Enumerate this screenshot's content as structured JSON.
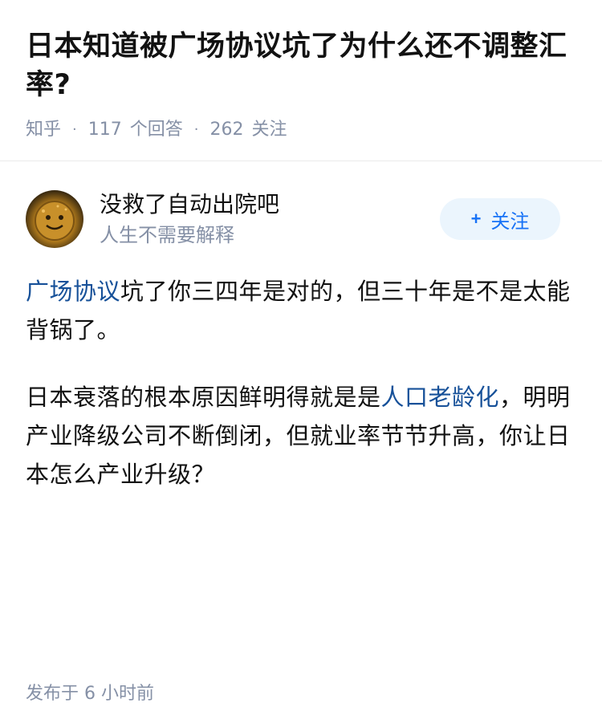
{
  "question": {
    "title": "日本知道被广场协议坑了为什么还不调整汇率?",
    "source": "知乎",
    "answer_count": "117",
    "answer_label": "个回答",
    "follower_count": "262",
    "follower_label": "关注"
  },
  "author": {
    "name": "没救了自动出院吧",
    "bio": "人生不需要解释",
    "avatar_icon": "avatar-image"
  },
  "follow_button": {
    "plus": "+",
    "label": "关注"
  },
  "answer": {
    "p1": {
      "link1": "广场协议",
      "text1": "坑了你三四年是对的，但三十年是不是太能背锅了。"
    },
    "p2": {
      "text1": "日本衰落的根本原因鲜明得就是是",
      "link1": "人口老龄化",
      "text2": "，明明产业降级公司不断倒闭，但就业率节节升高，你让日本怎么产业升级？"
    },
    "published": "发布于 6 小时前"
  },
  "colors": {
    "link": "#175199",
    "accent": "#1772f6",
    "muted": "#8590a6",
    "follow_bg": "#ebf5fd"
  }
}
